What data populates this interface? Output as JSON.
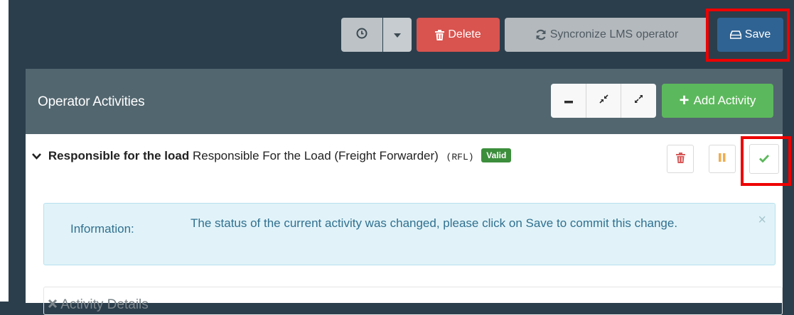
{
  "toolbar": {
    "delete_label": "Delete",
    "sync_label": "Syncronize LMS operator",
    "save_label": "Save",
    "icons": [
      "clock-icon",
      "caret-down-icon",
      "trash-icon",
      "refresh-icon",
      "hdd-icon"
    ]
  },
  "panel": {
    "title": "Operator Activities",
    "tools": [
      "minimize-icon",
      "compress-icon",
      "expand-icon"
    ],
    "add_label": "Add Activity"
  },
  "activity": {
    "name": "Responsible for the load",
    "description": "Responsible For the Load (Freight Forwarder)",
    "code": "(RFL)",
    "status_badge": "Valid"
  },
  "alert": {
    "label": "Information:",
    "message": "The status of the current activity was changed, please click on Save to commit this change.",
    "close": "×"
  },
  "details": {
    "title": "Activity Details"
  },
  "colors": {
    "background": "#2b3e4c",
    "panel_header": "#52666f",
    "delete": "#d9534f",
    "save": "#2f6393",
    "add": "#5cb85c",
    "valid_badge": "#3c8e3c",
    "highlight": "#ee0000"
  }
}
